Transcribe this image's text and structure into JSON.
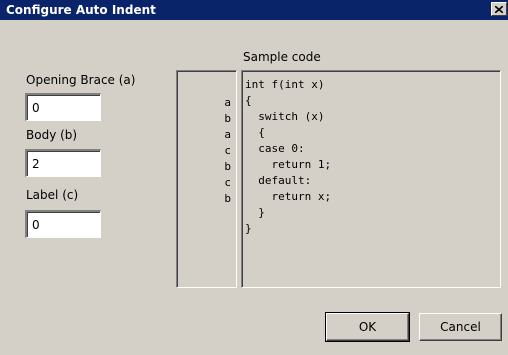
{
  "window": {
    "title": "Configure Auto Indent",
    "close_icon": "close-icon"
  },
  "fields": {
    "opening_brace": {
      "label": "Opening Brace (a)",
      "value": "0"
    },
    "body": {
      "label": "Body (b)",
      "value": "2"
    },
    "label": {
      "label": "Label (c)",
      "value": "0"
    }
  },
  "sample": {
    "heading": "Sample code",
    "indent_letters": [
      "a",
      "b",
      "a",
      "c",
      "b",
      "c",
      "b"
    ],
    "code_lines": [
      "int f(int x)",
      "{",
      "  switch (x)",
      "  {",
      "  case 0:",
      "    return 1;",
      "  default:",
      "    return x;",
      "  }",
      "}"
    ]
  },
  "buttons": {
    "ok": "OK",
    "cancel": "Cancel"
  },
  "colors": {
    "titlebar": "#0a246a",
    "dialog_bg": "#d4d0c8"
  }
}
